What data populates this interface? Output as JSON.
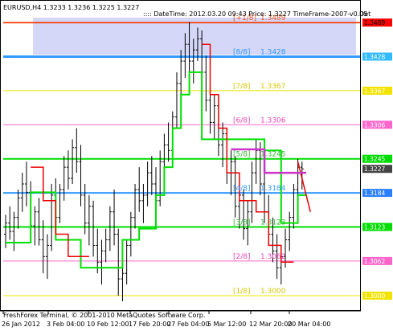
{
  "symbol_header": "EURUSD,H4  1.3233 1.3236 1.3225 1.3227",
  "info_bar": ":::: DateTime: 2012.03.20 09:43    Price: 1.3227    TimeFrame-2007-v0.05",
  "info_bar_tail": "Det",
  "copyright": "FreshForex Terminal, © 2001-2010 MetaQuotes Software Corp.",
  "colors": {
    "background": "#ffffff",
    "frame": "#000000",
    "shade": "#cfd3f7",
    "candles": "#000000",
    "green_step": "#00e000",
    "red_step": "#ee0000",
    "magenta_line": "#cc33cc"
  },
  "murrey_levels": [
    {
      "label": "[+1/8]",
      "value": "1.3489",
      "price": 1.3489,
      "color": "#f05020",
      "label_color": "#f05020",
      "tag_bg": "#ff0000",
      "tag_fg": "#000000",
      "tag": "1.3489",
      "thick": 2
    },
    {
      "label": "[8/8]",
      "value": "1.3428",
      "price": 1.3428,
      "color": "#3399ff",
      "label_color": "#3399ff",
      "tag_bg": "#33bbff",
      "tag_fg": "#ffffff",
      "tag": "1.3428",
      "thick": 3
    },
    {
      "label": "[7/8]",
      "value": "1.3367",
      "price": 1.3367,
      "color": "#f2e400",
      "label_color": "#d8c800",
      "tag_bg": "#f2e400",
      "tag_fg": "#ffffff",
      "tag": "1.3367",
      "thick": 1
    },
    {
      "label": "[6/8]",
      "value": "1.3306",
      "price": 1.3306,
      "color": "#ff66cc",
      "label_color": "#ee44bb",
      "tag_bg": "#ff66cc",
      "tag_fg": "#ffffff",
      "tag": "1.3306",
      "thick": 1
    },
    {
      "label": "[5/8]",
      "value": "1.3245",
      "price": 1.3245,
      "color": "#00dd00",
      "label_color": "#33bb33",
      "tag_bg": "#00dd00",
      "tag_fg": "#ffffff",
      "tag": "1.3245",
      "thick": 2
    },
    {
      "label": "[4/8]",
      "value": "1.3184",
      "price": 1.3184,
      "color": "#3399ff",
      "label_color": "#3399ff",
      "tag_bg": "#2a7fff",
      "tag_fg": "#ffffff",
      "tag": "1.3184",
      "thick": 2
    },
    {
      "label": "[3/8]",
      "value": "1.3123",
      "price": 1.3123,
      "color": "#00dd00",
      "label_color": "#33bb33",
      "tag_bg": "#00dd00",
      "tag_fg": "#ffffff",
      "tag": "1.3123",
      "thick": 2
    },
    {
      "label": "[2/8]",
      "value": "1.3062",
      "price": 1.3062,
      "color": "#ff66cc",
      "label_color": "#ee44bb",
      "tag_bg": "#ff66cc",
      "tag_fg": "#ffffff",
      "tag": "1.3062",
      "thick": 1
    },
    {
      "label": "[1/8]",
      "value": "1.3000",
      "price": 1.3,
      "color": "#f2e400",
      "label_color": "#d8c800",
      "tag_bg": "#f2e400",
      "tag_fg": "#ffffff",
      "tag": "1.3000",
      "thick": 1
    }
  ],
  "price_tags_extra": [
    {
      "value": "1.3227",
      "price": 1.3227,
      "tag_bg": "#444444",
      "tag_fg": "#ffffff"
    }
  ],
  "time_axis": [
    "26 Jan 2012",
    "3 Feb 04:00",
    "10 Feb 12:00",
    "17 Feb 20:00",
    "27 Feb 04:00",
    "5 Mar 12:00",
    "12 Mar 20:00",
    "20 Mar 04:00"
  ],
  "chart_data": {
    "type": "candlestick",
    "price_range": [
      1.2977,
      1.3515
    ],
    "levels": [
      1.3489,
      1.3428,
      1.3367,
      1.3306,
      1.3245,
      1.3184,
      1.3123,
      1.3062,
      1.3
    ],
    "current_price": 1.3227,
    "ohlc": [
      [
        1.311,
        1.3145,
        1.3085,
        1.313
      ],
      [
        1.313,
        1.316,
        1.31,
        1.3115
      ],
      [
        1.3115,
        1.315,
        1.308,
        1.314
      ],
      [
        1.314,
        1.319,
        1.312,
        1.3175
      ],
      [
        1.3175,
        1.322,
        1.315,
        1.32
      ],
      [
        1.32,
        1.324,
        1.316,
        1.3185
      ],
      [
        1.3185,
        1.3205,
        1.311,
        1.3125
      ],
      [
        1.3125,
        1.316,
        1.309,
        1.315
      ],
      [
        1.315,
        1.3175,
        1.309,
        1.31
      ],
      [
        1.31,
        1.3135,
        1.304,
        1.307
      ],
      [
        1.307,
        1.311,
        1.303,
        1.309
      ],
      [
        1.309,
        1.32,
        1.308,
        1.318
      ],
      [
        1.318,
        1.321,
        1.312,
        1.314
      ],
      [
        1.314,
        1.32,
        1.313,
        1.319
      ],
      [
        1.319,
        1.325,
        1.317,
        1.323
      ],
      [
        1.323,
        1.326,
        1.319,
        1.321
      ],
      [
        1.321,
        1.328,
        1.32,
        1.3265
      ],
      [
        1.3265,
        1.33,
        1.322,
        1.324
      ],
      [
        1.324,
        1.327,
        1.316,
        1.318
      ],
      [
        1.318,
        1.32,
        1.311,
        1.313
      ],
      [
        1.313,
        1.318,
        1.309,
        1.316
      ],
      [
        1.316,
        1.317,
        1.307,
        1.309
      ],
      [
        1.309,
        1.312,
        1.304,
        1.306
      ],
      [
        1.306,
        1.31,
        1.302,
        1.308
      ],
      [
        1.308,
        1.312,
        1.306,
        1.31
      ],
      [
        1.31,
        1.316,
        1.308,
        1.315
      ],
      [
        1.315,
        1.319,
        1.309,
        1.311
      ],
      [
        1.311,
        1.312,
        1.3,
        1.303
      ],
      [
        1.303,
        1.306,
        1.299,
        1.304
      ],
      [
        1.304,
        1.31,
        1.302,
        1.309
      ],
      [
        1.309,
        1.315,
        1.307,
        1.314
      ],
      [
        1.314,
        1.32,
        1.312,
        1.319
      ],
      [
        1.319,
        1.323,
        1.315,
        1.317
      ],
      [
        1.317,
        1.32,
        1.313,
        1.318
      ],
      [
        1.318,
        1.324,
        1.316,
        1.322
      ],
      [
        1.322,
        1.325,
        1.318,
        1.32
      ],
      [
        1.32,
        1.323,
        1.315,
        1.317
      ],
      [
        1.317,
        1.326,
        1.316,
        1.324
      ],
      [
        1.324,
        1.329,
        1.322,
        1.327
      ],
      [
        1.327,
        1.331,
        1.324,
        1.326
      ],
      [
        1.326,
        1.333,
        1.325,
        1.332
      ],
      [
        1.332,
        1.34,
        1.33,
        1.338
      ],
      [
        1.338,
        1.344,
        1.335,
        1.342
      ],
      [
        1.342,
        1.347,
        1.339,
        1.345
      ],
      [
        1.345,
        1.349,
        1.34,
        1.342
      ],
      [
        1.342,
        1.346,
        1.338,
        1.344
      ],
      [
        1.344,
        1.348,
        1.342,
        1.346
      ],
      [
        1.346,
        1.3475,
        1.338,
        1.34
      ],
      [
        1.34,
        1.343,
        1.333,
        1.335
      ],
      [
        1.335,
        1.338,
        1.329,
        1.331
      ],
      [
        1.331,
        1.336,
        1.328,
        1.334
      ],
      [
        1.334,
        1.335,
        1.325,
        1.327
      ],
      [
        1.327,
        1.331,
        1.323,
        1.329
      ],
      [
        1.329,
        1.33,
        1.32,
        1.322
      ],
      [
        1.322,
        1.326,
        1.318,
        1.324
      ],
      [
        1.324,
        1.325,
        1.314,
        1.316
      ],
      [
        1.316,
        1.32,
        1.312,
        1.318
      ],
      [
        1.318,
        1.319,
        1.31,
        1.312
      ],
      [
        1.312,
        1.317,
        1.309,
        1.315
      ],
      [
        1.315,
        1.324,
        1.313,
        1.322
      ],
      [
        1.322,
        1.328,
        1.32,
        1.326
      ],
      [
        1.326,
        1.3275,
        1.318,
        1.32
      ],
      [
        1.32,
        1.322,
        1.313,
        1.315
      ],
      [
        1.315,
        1.318,
        1.309,
        1.311
      ],
      [
        1.311,
        1.314,
        1.306,
        1.308
      ],
      [
        1.308,
        1.311,
        1.303,
        1.305
      ],
      [
        1.305,
        1.309,
        1.302,
        1.307
      ],
      [
        1.307,
        1.312,
        1.305,
        1.31
      ],
      [
        1.31,
        1.315,
        1.308,
        1.314
      ],
      [
        1.314,
        1.32,
        1.312,
        1.319
      ],
      [
        1.319,
        1.3245,
        1.317,
        1.323
      ],
      [
        1.323,
        1.324,
        1.319,
        1.3227
      ]
    ],
    "green_step": [
      [
        0,
        1.3095
      ],
      [
        6,
        1.3095
      ],
      [
        6,
        1.3185
      ],
      [
        12,
        1.3185
      ],
      [
        12,
        1.31
      ],
      [
        18,
        1.31
      ],
      [
        18,
        1.305
      ],
      [
        28,
        1.305
      ],
      [
        28,
        1.31
      ],
      [
        32,
        1.31
      ],
      [
        32,
        1.312
      ],
      [
        36,
        1.312
      ],
      [
        36,
        1.318
      ],
      [
        38,
        1.318
      ],
      [
        38,
        1.323
      ],
      [
        40,
        1.323
      ],
      [
        40,
        1.33
      ],
      [
        42,
        1.33
      ],
      [
        42,
        1.336
      ],
      [
        44,
        1.336
      ],
      [
        44,
        1.34
      ],
      [
        47,
        1.34
      ],
      [
        47,
        1.328
      ],
      [
        55,
        1.328
      ],
      [
        55,
        1.328
      ],
      [
        62,
        1.328
      ],
      [
        62,
        1.326
      ],
      [
        66,
        1.326
      ],
      [
        66,
        1.313
      ],
      [
        70,
        1.313
      ],
      [
        70,
        1.318
      ],
      [
        72,
        1.318
      ]
    ],
    "red_step": [
      [
        6,
        1.323
      ],
      [
        9,
        1.323
      ],
      [
        9,
        1.317
      ],
      [
        12,
        1.317
      ],
      [
        12,
        1.311
      ],
      [
        15,
        1.311
      ],
      [
        15,
        1.307
      ],
      [
        20,
        1.307
      ],
      [
        47,
        1.345
      ],
      [
        49,
        1.345
      ],
      [
        49,
        1.336
      ],
      [
        51,
        1.336
      ],
      [
        51,
        1.33
      ],
      [
        53,
        1.33
      ],
      [
        53,
        1.322
      ],
      [
        56,
        1.322
      ],
      [
        56,
        1.317
      ],
      [
        60,
        1.317
      ],
      [
        60,
        1.315
      ],
      [
        63,
        1.315
      ],
      [
        63,
        1.309
      ],
      [
        66,
        1.309
      ],
      [
        66,
        1.306
      ],
      [
        69,
        1.306
      ],
      [
        70,
        1.324
      ],
      [
        73,
        1.315
      ]
    ],
    "magenta_line": [
      [
        54,
        1.3262
      ],
      [
        62,
        1.3262
      ],
      [
        62,
        1.322
      ],
      [
        72,
        1.322
      ]
    ]
  }
}
